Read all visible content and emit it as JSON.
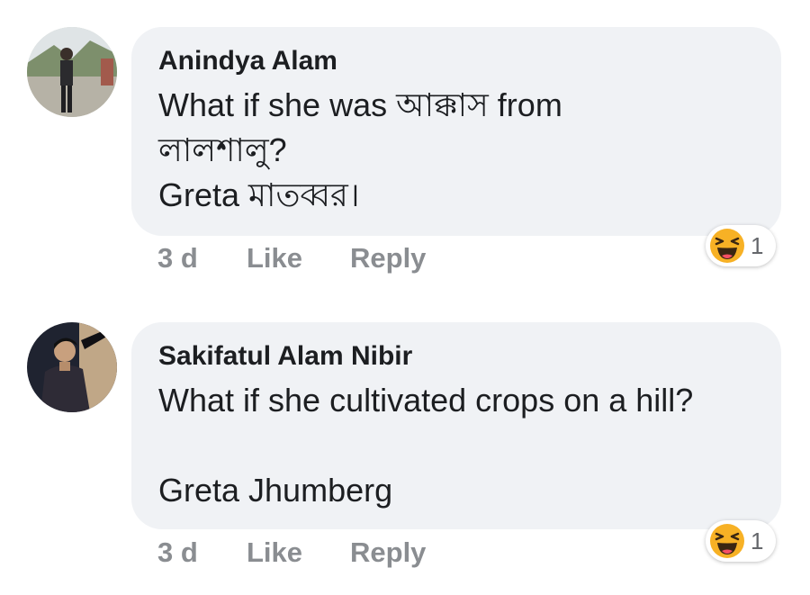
{
  "comments": [
    {
      "author": "Anindya Alam",
      "lines": [
        "What if she was আক্কাস from",
        "লালশালু?",
        "Greta মাতব্বর।"
      ],
      "time": "3 d",
      "like_label": "Like",
      "reply_label": "Reply",
      "reaction": {
        "icon": "haha-emoji-icon",
        "count": "1"
      }
    },
    {
      "author": "Sakifatul Alam Nibir",
      "lines": [
        "What if she cultivated crops on a hill?",
        "",
        "Greta Jhumberg"
      ],
      "time": "3 d",
      "like_label": "Like",
      "reply_label": "Reply",
      "reaction": {
        "icon": "haha-emoji-icon",
        "count": "1"
      }
    }
  ],
  "colors": {
    "bubble": "#f0f2f5",
    "text": "#1c1e21",
    "action_text": "#8a8d91",
    "emoji_yellow": "#f7b125"
  }
}
